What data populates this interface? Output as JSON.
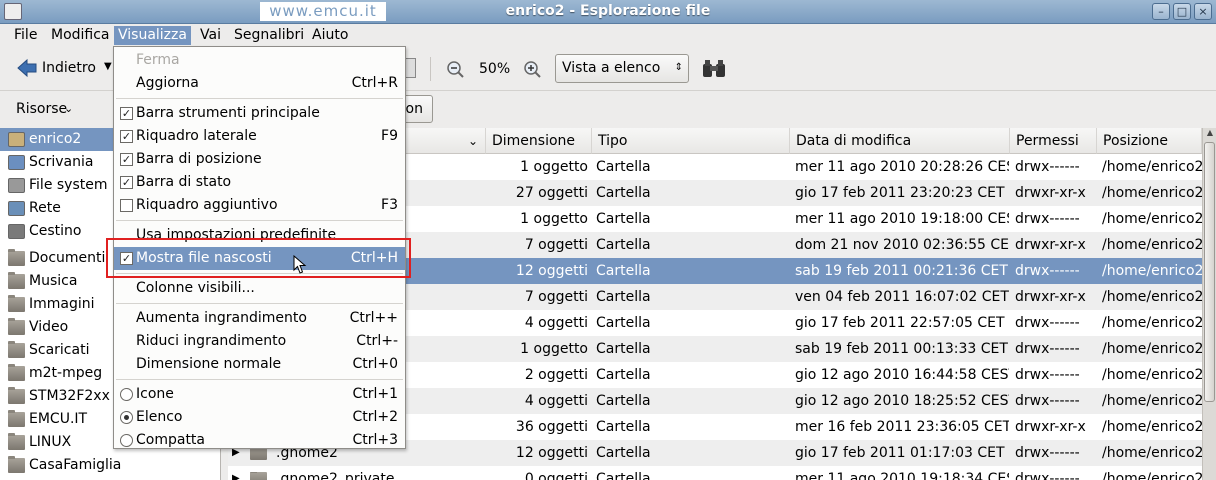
{
  "window": {
    "title": "enrico2 - Esplorazione file",
    "watermark": "www.emcu.it"
  },
  "menubar": [
    "File",
    "Modifica",
    "Visualizza",
    "Vai",
    "Segnalibri",
    "Aiuto"
  ],
  "toolbar": {
    "back_label": "Indietro",
    "zoom": "50%",
    "view_mode": "Vista a elenco"
  },
  "locbar": {
    "places_label": "Risorse",
    "location_button": "on"
  },
  "sidebar": [
    {
      "label": "enrico2",
      "icon": "home-icon",
      "selected": true
    },
    {
      "label": "Scrivania",
      "icon": "desktop-icon"
    },
    {
      "label": "File system",
      "icon": "filesystem-icon"
    },
    {
      "label": "Rete",
      "icon": "network-icon"
    },
    {
      "label": "Cestino",
      "icon": "trash-icon"
    },
    {
      "label": "Documenti",
      "icon": "folder-icon"
    },
    {
      "label": "Musica",
      "icon": "folder-icon"
    },
    {
      "label": "Immagini",
      "icon": "folder-icon"
    },
    {
      "label": "Video",
      "icon": "folder-icon"
    },
    {
      "label": "Scaricati",
      "icon": "folder-icon"
    },
    {
      "label": "m2t-mpeg",
      "icon": "folder-icon"
    },
    {
      "label": "STM32F2xx",
      "icon": "folder-icon"
    },
    {
      "label": "EMCU.IT",
      "icon": "folder-icon"
    },
    {
      "label": "LINUX",
      "icon": "folder-icon"
    },
    {
      "label": "CasaFamiglia",
      "icon": "folder-icon"
    }
  ],
  "list": {
    "columns": [
      "Dimensione",
      "Tipo",
      "Data di modifica",
      "Permessi",
      "Posizione"
    ],
    "rows": [
      {
        "name": "",
        "size": "1 oggetto",
        "type": "Cartella",
        "date": "mer 11 ago 2010 20:28:26 CEST",
        "perm": "drwx------",
        "pos": "/home/enrico2"
      },
      {
        "name": "",
        "size": "27 oggetti",
        "type": "Cartella",
        "date": "gio 17 feb 2011 23:20:23 CET",
        "perm": "drwxr-xr-x",
        "pos": "/home/enrico2"
      },
      {
        "name": "",
        "size": "1 oggetto",
        "type": "Cartella",
        "date": "mer 11 ago 2010 19:18:00 CEST",
        "perm": "drwx------",
        "pos": "/home/enrico2"
      },
      {
        "name": "",
        "size": "7 oggetti",
        "type": "Cartella",
        "date": "dom 21 nov 2010 02:36:55 CET",
        "perm": "drwxr-xr-x",
        "pos": "/home/enrico2"
      },
      {
        "name": "",
        "size": "12 oggetti",
        "type": "Cartella",
        "date": "sab 19 feb 2011 00:21:36 CET",
        "perm": "drwx------",
        "pos": "/home/enrico2",
        "selected": true
      },
      {
        "name": "",
        "size": "7 oggetti",
        "type": "Cartella",
        "date": "ven 04 feb 2011 16:07:02 CET",
        "perm": "drwxr-xr-x",
        "pos": "/home/enrico2"
      },
      {
        "name": "",
        "size": "4 oggetti",
        "type": "Cartella",
        "date": "gio 17 feb 2011 22:57:05 CET",
        "perm": "drwx------",
        "pos": "/home/enrico2"
      },
      {
        "name": "",
        "size": "1 oggetto",
        "type": "Cartella",
        "date": "sab 19 feb 2011 00:13:33 CET",
        "perm": "drwx------",
        "pos": "/home/enrico2"
      },
      {
        "name": "",
        "size": "2 oggetti",
        "type": "Cartella",
        "date": "gio 12 ago 2010 16:44:58 CEST",
        "perm": "drwx------",
        "pos": "/home/enrico2"
      },
      {
        "name": "",
        "size": "4 oggetti",
        "type": "Cartella",
        "date": "gio 12 ago 2010 18:25:52 CEST",
        "perm": "drwx------",
        "pos": "/home/enrico2"
      },
      {
        "name": "",
        "size": "36 oggetti",
        "type": "Cartella",
        "date": "mer 16 feb 2011 23:36:05 CET",
        "perm": "drwxr-xr-x",
        "pos": "/home/enrico2"
      },
      {
        "name": ".gnome2",
        "size": "12 oggetti",
        "type": "Cartella",
        "date": "gio 17 feb 2011 01:17:03 CET",
        "perm": "drwx------",
        "pos": "/home/enrico2"
      },
      {
        "name": ".gnome2_private",
        "size": "0 oggetti",
        "type": "Cartella",
        "date": "mer 11 ago 2010 19:18:34 CEST",
        "perm": "drwx------",
        "pos": "/home/enrico2"
      }
    ]
  },
  "menu": {
    "items": [
      {
        "label": "Ferma",
        "disabled": true
      },
      {
        "label": "Aggiorna",
        "accel": "Ctrl+R"
      },
      {
        "sep": true
      },
      {
        "label": "Barra strumenti principale",
        "check": true
      },
      {
        "label": "Riquadro laterale",
        "check": true,
        "accel": "F9"
      },
      {
        "label": "Barra di posizione",
        "check": true
      },
      {
        "label": "Barra di stato",
        "check": true
      },
      {
        "label": "Riquadro aggiuntivo",
        "check": false,
        "accel": "F3"
      },
      {
        "sep": true
      },
      {
        "label": "Usa impostazioni predefinite"
      },
      {
        "label": "Mostra file nascosti",
        "check": true,
        "accel": "Ctrl+H",
        "highlighted": true
      },
      {
        "sep": true
      },
      {
        "label": "Colonne visibili..."
      },
      {
        "sep": true
      },
      {
        "label": "Aumenta ingrandimento",
        "accel": "Ctrl++"
      },
      {
        "label": "Riduci ingrandimento",
        "accel": "Ctrl+-"
      },
      {
        "label": "Dimensione normale",
        "accel": "Ctrl+0"
      },
      {
        "sep": true
      },
      {
        "label": "Icone",
        "radio": false,
        "accel": "Ctrl+1"
      },
      {
        "label": "Elenco",
        "radio": true,
        "accel": "Ctrl+2"
      },
      {
        "label": "Compatta",
        "radio": false,
        "accel": "Ctrl+3"
      }
    ]
  },
  "colors": {
    "accent": "#7595c0",
    "highlight_box": "#e02020"
  }
}
